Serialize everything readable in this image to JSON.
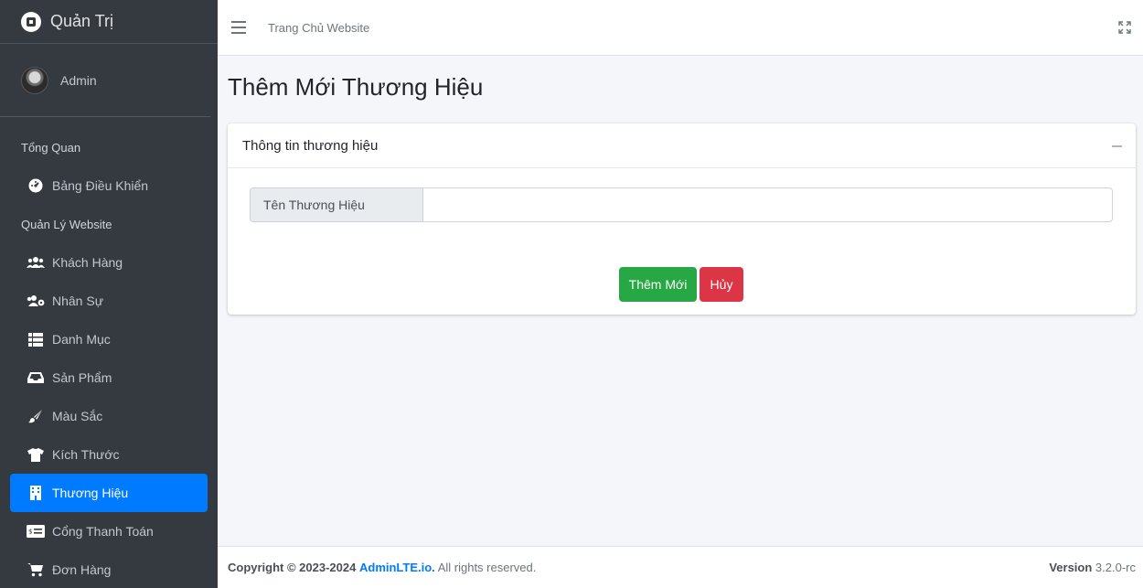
{
  "sidebar": {
    "brand": "Quản Trị",
    "user": "Admin",
    "headers": [
      "Tổng Quan",
      "Quản Lý Website"
    ],
    "items": [
      {
        "label": "Bảng Điều Khiển",
        "icon": "tachometer-icon"
      },
      {
        "label": "Khách Hàng",
        "icon": "users-icon"
      },
      {
        "label": "Nhân Sự",
        "icon": "users-cog-icon"
      },
      {
        "label": "Danh Mục",
        "icon": "list-icon"
      },
      {
        "label": "Sản Phẩm",
        "icon": "inbox-icon"
      },
      {
        "label": "Màu Sắc",
        "icon": "paint-brush-icon"
      },
      {
        "label": "Kích Thước",
        "icon": "tshirt-icon"
      },
      {
        "label": "Thương Hiệu",
        "icon": "building-icon",
        "active": true
      },
      {
        "label": "Cổng Thanh Toán",
        "icon": "money-check-icon"
      },
      {
        "label": "Đơn Hàng",
        "icon": "cart-icon"
      }
    ]
  },
  "navbar": {
    "home_link": "Trang Chủ Website"
  },
  "page": {
    "title": "Thêm Mới Thương Hiệu",
    "card_title": "Thông tin thương hiệu",
    "field_label": "Tên Thương Hiệu",
    "field_value": "",
    "submit_label": "Thêm Mới",
    "cancel_label": "Hủy"
  },
  "footer": {
    "copyright": "Copyright © 2023-2024",
    "brand_link": "AdminLTE.io.",
    "rights": "All rights reserved.",
    "version_label": "Version",
    "version_value": "3.2.0-rc"
  },
  "colors": {
    "sidebar_bg": "#343a40",
    "active": "#007bff",
    "success": "#28a745",
    "danger": "#dc3545"
  }
}
